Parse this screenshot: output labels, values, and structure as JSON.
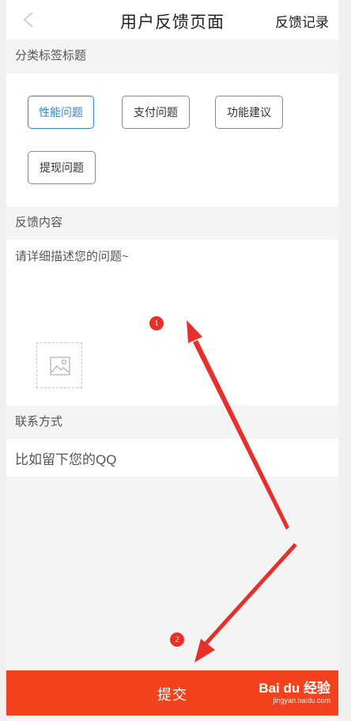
{
  "header": {
    "title": "用户反馈页面",
    "record_link": "反馈记录"
  },
  "sections": {
    "category_label": "分类标签标题",
    "content_label": "反馈内容",
    "contact_label": "联系方式"
  },
  "tags": [
    {
      "label": "性能问题",
      "selected": true
    },
    {
      "label": "支付问题",
      "selected": false
    },
    {
      "label": "功能建议",
      "selected": false
    },
    {
      "label": "提现问题",
      "selected": false
    }
  ],
  "feedback": {
    "placeholder": "请详细描述您的问题~"
  },
  "contact": {
    "placeholder": "比如留下您的QQ"
  },
  "submit": {
    "label": "提交"
  },
  "annotations": {
    "badge_1": "1",
    "badge_2": "2"
  },
  "watermark": {
    "brand": "Bai du 经验",
    "url": "jingyan.baidu.com"
  },
  "colors": {
    "accent_blue": "#2f86d6",
    "submit_red": "#f4421e",
    "arrow_red": "#e8302a"
  }
}
